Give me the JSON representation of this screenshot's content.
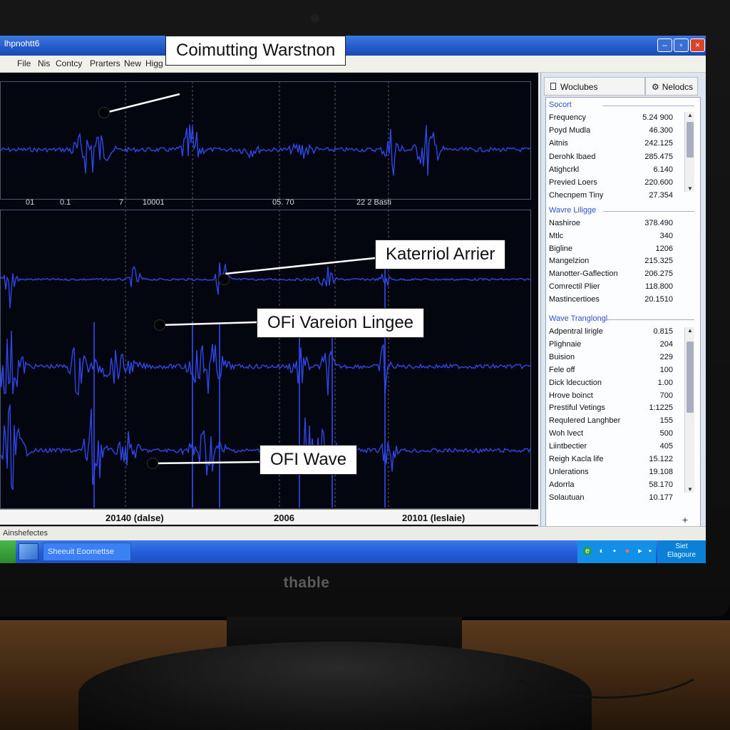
{
  "window": {
    "title": "lhpnohtt6"
  },
  "menu": {
    "items": [
      "File",
      "Nis",
      "Contcy",
      "Prarters",
      "New",
      "Higg"
    ]
  },
  "waveform": {
    "top_axis_ticks": [
      "01",
      "0.1",
      "7",
      "10001",
      "05. 70",
      "22 2 Basti"
    ],
    "bottom_axis_ticks": [
      "20140 (dalse)",
      "2006",
      "20101 (leslaie)"
    ],
    "colors": {
      "wave": "#2f47e8",
      "background": "#04060f",
      "grid": "#9aa3b8"
    }
  },
  "callouts": {
    "top": "Coimutting Warstnon",
    "middle": "Katerriol Arrier",
    "lower": "OFi Vareion Lingee",
    "bottom": "OFI Wave"
  },
  "side_panel": {
    "tabs": [
      "Woclubes",
      "Nelodcs"
    ],
    "groups": [
      {
        "title": "Socort",
        "rows": [
          {
            "label": "Frequency",
            "value": "5.24 900"
          },
          {
            "label": "Poyd Mudla",
            "value": "46.300"
          },
          {
            "label": "Aitnis",
            "value": "242.125"
          },
          {
            "label": "Derohk lbaed",
            "value": "285.475"
          },
          {
            "label": "Atighcrkl",
            "value": "6.140"
          },
          {
            "label": "Previed Loers",
            "value": "220.600"
          },
          {
            "label": "Checnpem Tiny",
            "value": "27.354"
          }
        ]
      },
      {
        "title": "Wavre Liligge",
        "rows": [
          {
            "label": "Nashiroe",
            "value": "378.490"
          },
          {
            "label": "Mtlc",
            "value": "340"
          },
          {
            "label": "Bigline",
            "value": "1206"
          },
          {
            "label": "Mangelzion",
            "value": "215.325"
          },
          {
            "label": "Manotter-Gaflection",
            "value": "206.275"
          },
          {
            "label": "Comrectil Plier",
            "value": "118.800"
          },
          {
            "label": "Mastincertioes",
            "value": "20.1510"
          }
        ]
      },
      {
        "title": "Wave Tranglongl",
        "rows": [
          {
            "label": "Adpentral lirigle",
            "value": "0.815"
          },
          {
            "label": "Plighnaie",
            "value": "204"
          },
          {
            "label": "Buision",
            "value": "229"
          },
          {
            "label": "Fele off",
            "value": "100"
          },
          {
            "label": "Dick ldecuction",
            "value": "1.00"
          },
          {
            "label": "Hrove boinct",
            "value": "700"
          },
          {
            "label": "Prestiful Vetings",
            "value": "1:1225"
          },
          {
            "label": "Requlered Langhber",
            "value": "155"
          },
          {
            "label": "Woh lvect",
            "value": "500"
          },
          {
            "label": "Liintbectier",
            "value": "405"
          },
          {
            "label": "Reigh Kacla life",
            "value": "15.122"
          },
          {
            "label": "Unlerations",
            "value": "19.108"
          },
          {
            "label": "Adorrla",
            "value": "58.170"
          },
          {
            "label": "Solautuan",
            "value": "10.177"
          }
        ]
      }
    ]
  },
  "status_bar": {
    "text": "Ainshefectes"
  },
  "taskbar": {
    "task_label": "Sheeuit Eoomettse",
    "clock": [
      "Siet",
      "Elagoure"
    ]
  },
  "monitor": {
    "brand": "thable"
  }
}
